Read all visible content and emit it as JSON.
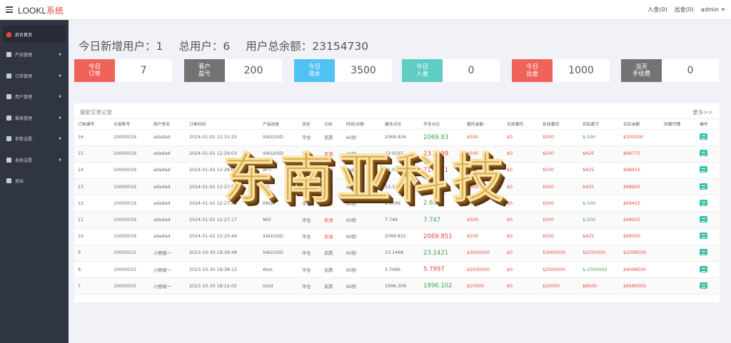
{
  "header": {
    "brand_a": "LOOKL",
    "brand_b": "系统",
    "deposit": "入金(0)",
    "withdraw": "出金(0)",
    "user": "admin"
  },
  "sidebar": {
    "items": [
      {
        "label": "后台首页",
        "icon": "dashboard-icon",
        "active": true
      },
      {
        "label": "产品管理",
        "icon": "bitcoin-icon"
      },
      {
        "label": "订单管理",
        "icon": "order-icon"
      },
      {
        "label": "用户管理",
        "icon": "user-icon"
      },
      {
        "label": "报表管理",
        "icon": "report-icon"
      },
      {
        "label": "参数设置",
        "icon": "gear-icon"
      },
      {
        "label": "系统设置",
        "icon": "gears-icon"
      },
      {
        "label": "退出",
        "icon": "logout-icon"
      }
    ]
  },
  "summary": {
    "new_users": "今日新增用户：1",
    "total_users": "总用户：6",
    "total_balance": "用户总余额：23154730"
  },
  "cards": [
    {
      "label": "今日\n订单",
      "value": "7",
      "color": "#f0635a"
    },
    {
      "label": "客户\n盈亏",
      "value": "200",
      "color": "#737373"
    },
    {
      "label": "今日\n流水",
      "value": "3500",
      "color": "#4fc3f1"
    },
    {
      "label": "今日\n入金",
      "value": "0",
      "color": "#5ecdc4"
    },
    {
      "label": "今日\n出金",
      "value": "1000",
      "color": "#f0635a"
    },
    {
      "label": "当天\n手续费",
      "value": "0",
      "color": "#737373"
    }
  ],
  "panel": {
    "title": "最新交易记录",
    "more": "更多>>"
  },
  "table": {
    "columns": [
      "订单编号",
      "交易账号",
      "用户姓名",
      "订单时间",
      "产品信息",
      "状态",
      "方向",
      "时间/点数",
      "建仓点位",
      "平仓点位",
      "委托金额",
      "无效委托",
      "有效委托",
      "实际盈亏",
      "买后余额",
      "所属代理",
      "操作"
    ],
    "rows": [
      [
        "16",
        "10000019",
        "adadad",
        "2024-01-02 12:31:23",
        "XAU/USD",
        "平仓",
        "买跌",
        "60秒",
        "2069.834",
        "2069.83",
        "$500",
        "$0",
        "$500",
        "$-500",
        "$100200",
        "",
        ""
      ],
      [
        "15",
        "10000019",
        "adadad",
        "2024-01-02 12:29:03",
        "XAG/USD",
        "平仓",
        "买涨",
        "60秒",
        "23.9197",
        "23.9199",
        "$500",
        "$0",
        "$500",
        "$425",
        "$99775",
        "",
        ""
      ],
      [
        "14",
        "10000019",
        "adadad",
        "2024-01-02 12:28:08",
        "WTI",
        "平仓",
        "买涨",
        "60秒",
        "71.0968",
        "71.0971",
        "$500",
        "$0",
        "$500",
        "$425",
        "$98425",
        "",
        ""
      ],
      [
        "13",
        "10000019",
        "adadad",
        "2024-01-02 12:27:50",
        "HG",
        "平仓",
        "买跌",
        "60秒",
        "13.1207",
        "13.1009",
        "$500",
        "$0",
        "$500",
        "$425",
        "$98925",
        "",
        ""
      ],
      [
        "12",
        "10000019",
        "adadad",
        "2024-01-02 12:27:40",
        "RBOX",
        "平仓",
        "买跌",
        "60秒",
        "2.6596",
        "2.6557",
        "$500",
        "$0",
        "$500",
        "$-500",
        "$99425",
        "",
        ""
      ],
      [
        "11",
        "10000019",
        "adadad",
        "2024-01-02 12:27:17",
        "NIO",
        "平仓",
        "买涨",
        "60秒",
        "7.749",
        "7.747",
        "$500",
        "$0",
        "$500",
        "$-500",
        "$99925",
        "",
        ""
      ],
      [
        "10",
        "10000019",
        "adadad",
        "2024-01-02 12:25:44",
        "XAU/USD",
        "平仓",
        "买涨",
        "60秒",
        "2069.831",
        "2069.851",
        "$500",
        "$0",
        "$500",
        "$425",
        "$99500",
        "",
        ""
      ],
      [
        "9",
        "10000015",
        "小野新一",
        "2023-10-30 19:39:48",
        "XAG/USD",
        "平仓",
        "买跌",
        "60秒",
        "23.1468",
        "23.1421",
        "$3000000",
        "$0",
        "$3000000",
        "$2550000",
        "$1098500",
        "",
        ""
      ],
      [
        "8",
        "10000015",
        "小野新一",
        "2023-10-30 19:38:13",
        "Atos",
        "平仓",
        "买跌",
        "60秒",
        "5.7989",
        "5.7997",
        "$2500000",
        "$0",
        "$2500000",
        "$-2500000",
        "$4098500",
        "",
        ""
      ],
      [
        "7",
        "10000015",
        "小野新一",
        "2023-10-30 18:12:05",
        "Gold",
        "平仓",
        "买跌",
        "60秒",
        "1996.309",
        "1996.102",
        "$10000",
        "$0",
        "$10000",
        "$8500",
        "$6580000",
        "",
        ""
      ]
    ]
  },
  "watermark": {
    "text": "东南亚科技"
  }
}
